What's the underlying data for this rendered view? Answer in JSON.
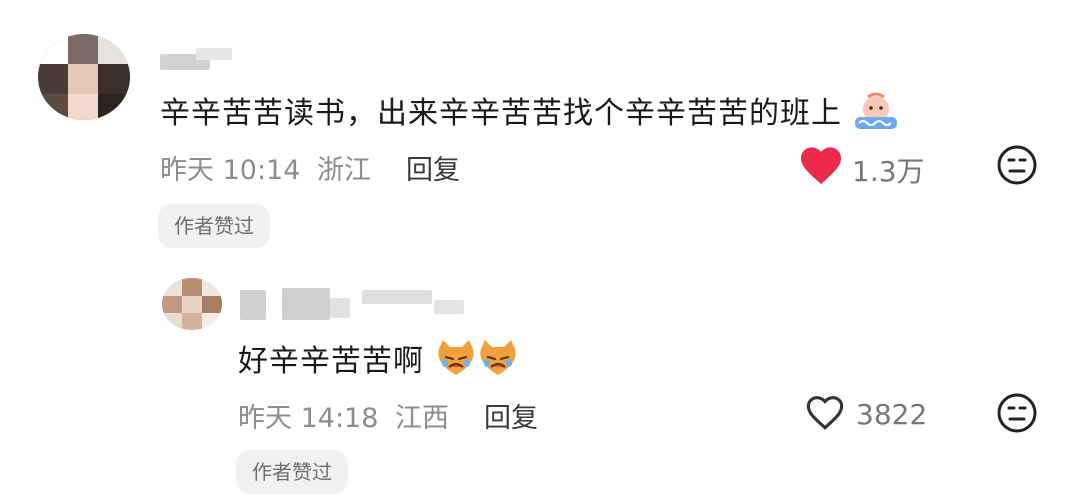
{
  "comments": [
    {
      "text": "辛辛苦苦读书，出来辛辛苦苦找个辛辛苦苦的班上",
      "time": "昨天 10:14",
      "location": "浙江",
      "reply_label": "回复",
      "likes": "1.3万",
      "liked": true,
      "badge": "作者赞过",
      "emoji": "crying-face-emoji"
    },
    {
      "text": "好辛辛苦苦啊",
      "time": "昨天 14:18",
      "location": "江西",
      "reply_label": "回复",
      "likes": "3822",
      "liked": false,
      "badge": "作者赞过",
      "emoji": "crying-cat-emoji"
    }
  ],
  "colors": {
    "like_red": "#ee2a4b",
    "meta_gray": "#8d8d8d",
    "badge_bg": "#f1f1f1"
  }
}
